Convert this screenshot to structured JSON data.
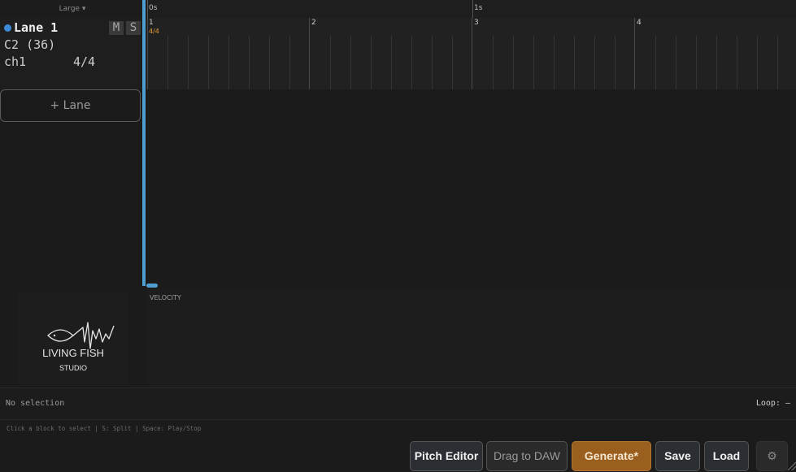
{
  "toolbar": {
    "zoom": "Large ▾"
  },
  "lane": {
    "name": "Lane 1",
    "mute_label": "M",
    "solo_label": "S",
    "note": "C2 (36)",
    "channel": "ch1",
    "meter": "4/4",
    "color": "#3d8bd8"
  },
  "add_lane_label": "+ Lane",
  "timeline": {
    "time_markers": [
      "0s",
      "1s"
    ],
    "bars": [
      "1",
      "2",
      "3",
      "4"
    ],
    "time_signature": "4/4"
  },
  "logo": {
    "name": "LIVING FISH",
    "sub": "STUDIO"
  },
  "velocity": {
    "label": "VELOCITY"
  },
  "status": {
    "selection": "No selection",
    "loop": "Loop: –",
    "hint": "Click a block to select | S: Split | Space: Play/Stop"
  },
  "buttons": {
    "pitch_editor": "Pitch Editor",
    "drag_to_daw": "Drag to DAW",
    "generate": "Generate*",
    "save": "Save",
    "load": "Load",
    "settings_icon": "gear-icon"
  },
  "colors": {
    "accent": "#4e9fd0",
    "generate": "#9a5e1e",
    "timesig": "#e39a3a"
  }
}
